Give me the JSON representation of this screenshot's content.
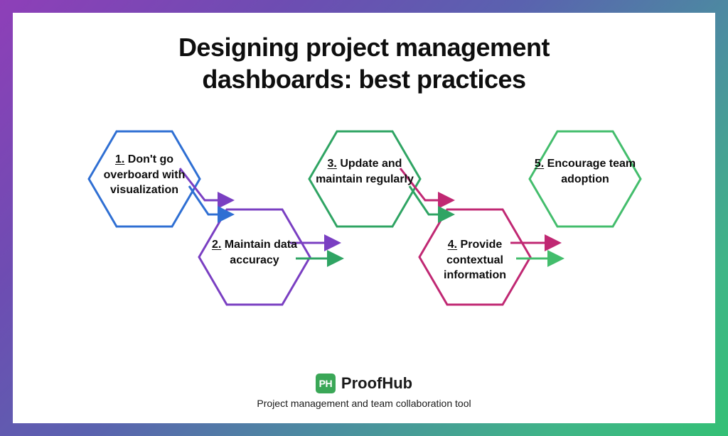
{
  "title_line1": "Designing project management",
  "title_line2": "dashboards: best practices",
  "hexes": [
    {
      "num": "1.",
      "text": "Don't go overboard with visualization",
      "color": "#2f6fd3"
    },
    {
      "num": "2.",
      "text": "Maintain data accuracy",
      "color": "#7a3fc2"
    },
    {
      "num": "3.",
      "text": "Update and maintain regularly",
      "color": "#2fa463"
    },
    {
      "num": "4.",
      "text": "Provide contextual information",
      "color": "#c02873"
    },
    {
      "num": "5.",
      "text": "Encourage team adoption",
      "color": "#43bd6c"
    }
  ],
  "brand": {
    "badge": "PH",
    "name": "ProofHub",
    "tagline": "Project management and team collaboration tool"
  }
}
